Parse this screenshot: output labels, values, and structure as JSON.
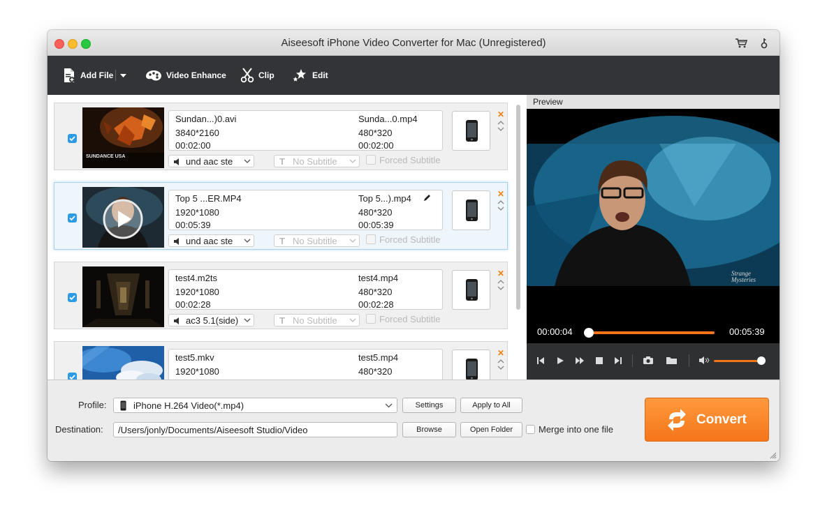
{
  "window": {
    "title": "Aiseesoft iPhone Video Converter for Mac (Unregistered)"
  },
  "toolbar": {
    "add_file": "Add File",
    "video_enhance": "Video Enhance",
    "clip": "Clip",
    "edit": "Edit"
  },
  "files": [
    {
      "source_name": "Sundan...)0.avi",
      "source_res": "3840*2160",
      "source_dur": "00:02:00",
      "out_name": "Sunda...0.mp4",
      "out_res": "480*320",
      "out_dur": "00:02:00",
      "audio": "und aac ste",
      "subtitle": "No Subtitle",
      "forced": "Forced Subtitle",
      "thumb_text": "SUNDANCE USA"
    },
    {
      "source_name": "Top 5 ...ER.MP4",
      "source_res": "1920*1080",
      "source_dur": "00:05:39",
      "out_name": "Top 5...).mp4",
      "out_res": "480*320",
      "out_dur": "00:05:39",
      "audio": "und aac ste",
      "subtitle": "No Subtitle",
      "forced": "Forced Subtitle"
    },
    {
      "source_name": "test4.m2ts",
      "source_res": "1920*1080",
      "source_dur": "00:02:28",
      "out_name": "test4.mp4",
      "out_res": "480*320",
      "out_dur": "00:02:28",
      "audio": "ac3 5.1(side)",
      "subtitle": "No Subtitle",
      "forced": "Forced Subtitle"
    },
    {
      "source_name": "test5.mkv",
      "source_res": "1920*1080",
      "source_dur": "",
      "out_name": "test5.mp4",
      "out_res": "480*320",
      "out_dur": ""
    }
  ],
  "preview": {
    "label": "Preview",
    "watermark": "Strange Mysteries",
    "current_time": "00:00:04",
    "total_time": "00:05:39",
    "progress": 0.0,
    "volume": 0.85
  },
  "bottom": {
    "profile_label": "Profile:",
    "profile_value": "iPhone H.264 Video(*.mp4)",
    "settings": "Settings",
    "apply_all": "Apply to All",
    "destination_label": "Destination:",
    "destination_value": "/Users/jonly/Documents/Aiseesoft Studio/Video",
    "browse": "Browse",
    "open_folder": "Open Folder",
    "merge": "Merge into one file",
    "convert": "Convert"
  },
  "colors": {
    "accent_orange": "#f5751a",
    "check_blue": "#2c9be6",
    "toolbar_bg": "#333437"
  }
}
